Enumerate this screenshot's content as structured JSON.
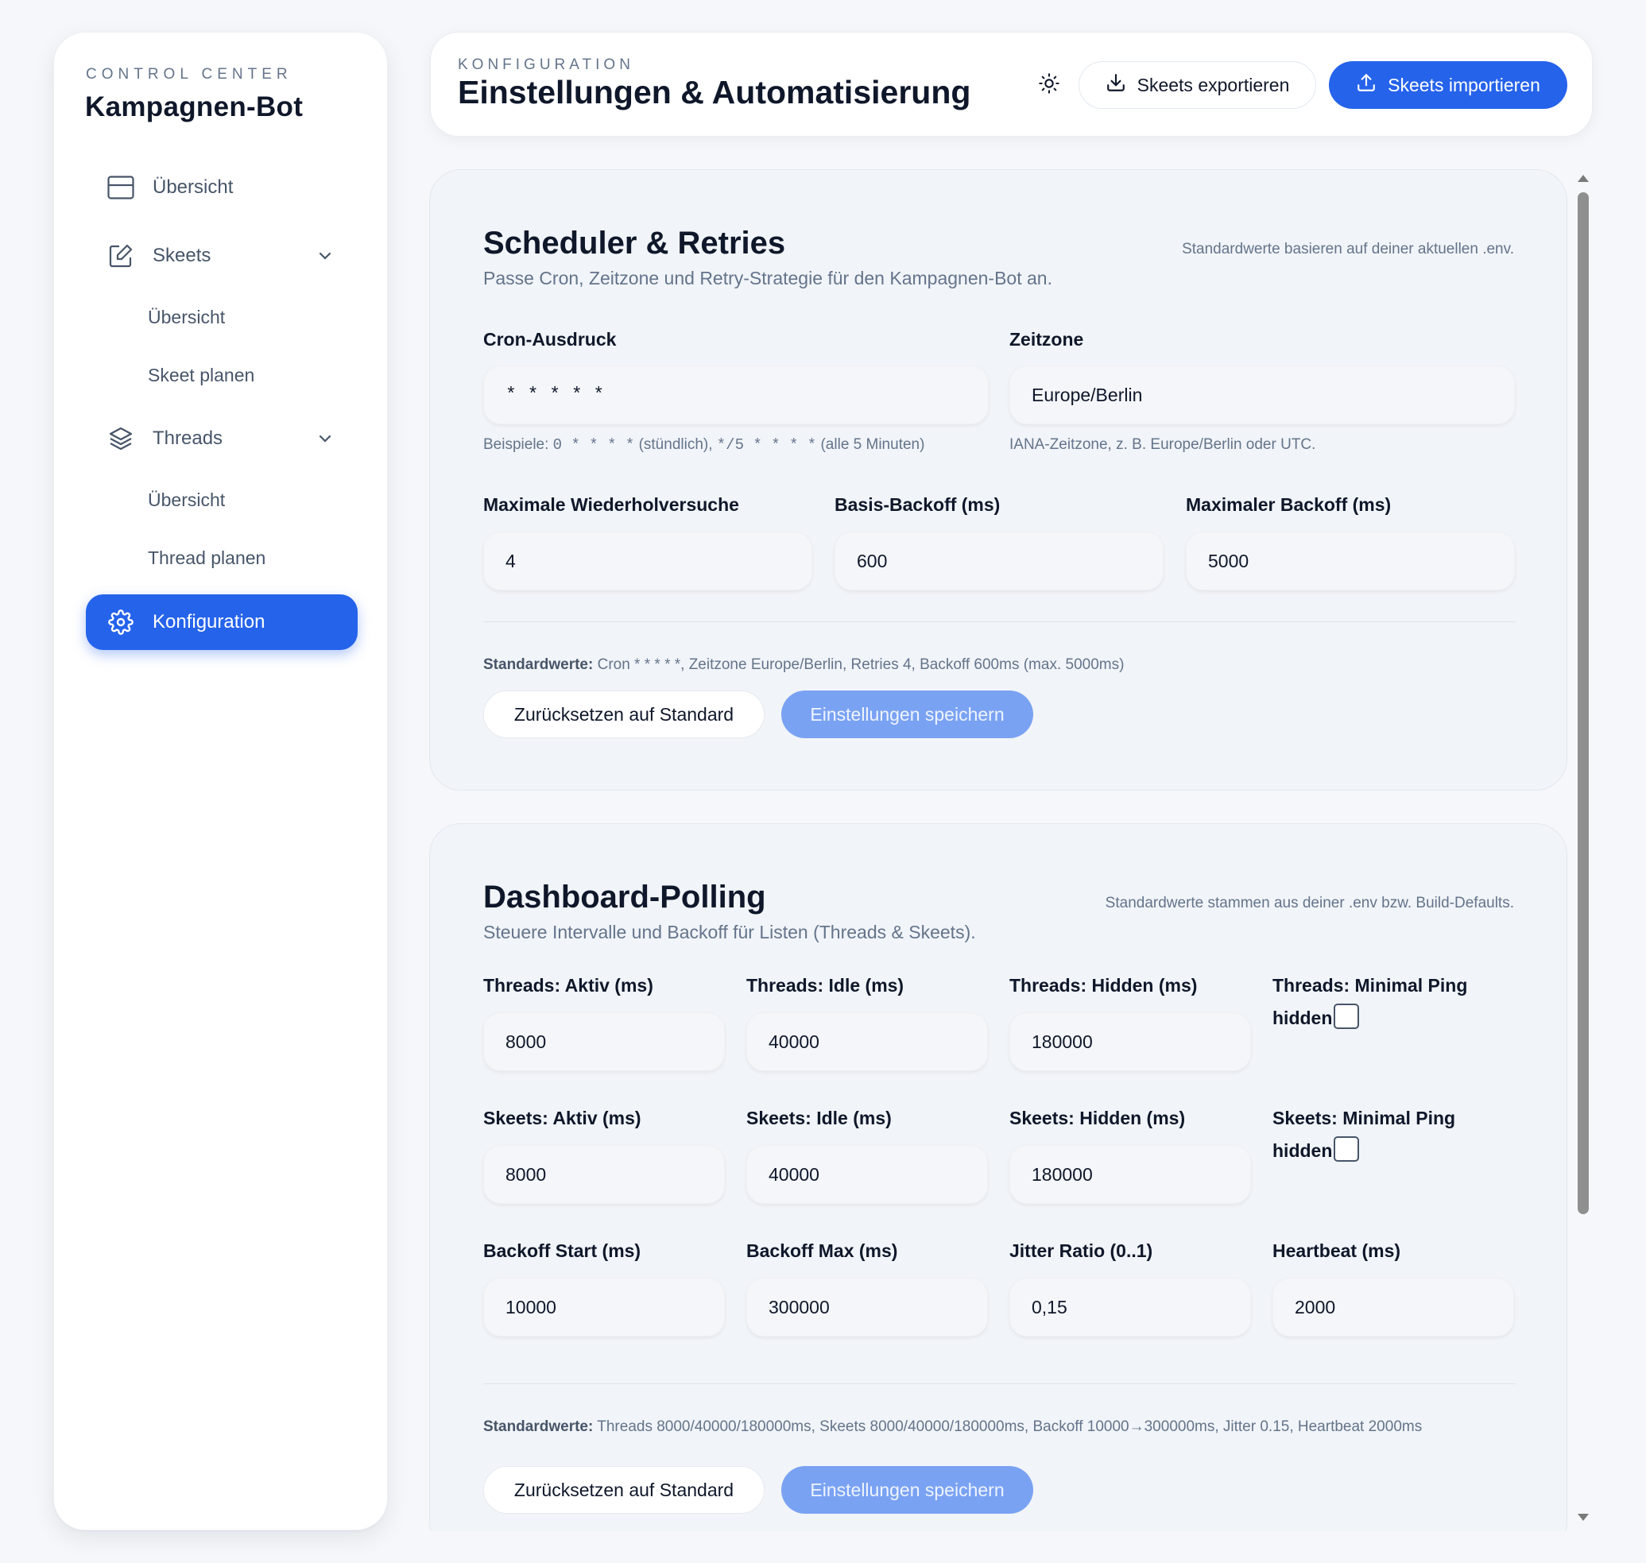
{
  "sidebar": {
    "kicker": "CONTROL CENTER",
    "title": "Kampagnen-Bot",
    "items": [
      {
        "label": "Übersicht",
        "icon": "layout-icon"
      },
      {
        "label": "Skeets",
        "icon": "edit-icon"
      },
      {
        "label": "Übersicht"
      },
      {
        "label": "Skeet planen"
      },
      {
        "label": "Threads",
        "icon": "layers-icon"
      },
      {
        "label": "Übersicht"
      },
      {
        "label": "Thread planen"
      },
      {
        "label": "Konfiguration",
        "icon": "gear-icon",
        "active": true
      }
    ]
  },
  "header": {
    "kicker": "KONFIGURATION",
    "title": "Einstellungen & Automatisierung",
    "export_label": "Skeets exportieren",
    "import_label": "Skeets importieren"
  },
  "scheduler": {
    "title": "Scheduler & Retries",
    "subtitle": "Passe Cron, Zeitzone und Retry-Strategie für den Kampagnen-Bot an.",
    "note": "Standardwerte basieren auf deiner aktuellen .env.",
    "cron_label": "Cron-Ausdruck",
    "cron_value": "* * * * *",
    "cron_help_prefix": "Beispiele: ",
    "cron_help_ex1": "0 * * * *",
    "cron_help_mid": " (stündlich), ",
    "cron_help_ex2": "*/5 * * * *",
    "cron_help_suffix": " (alle 5 Minuten)",
    "tz_label": "Zeitzone",
    "tz_value": "Europe/Berlin",
    "tz_help": "IANA-Zeitzone, z. B. Europe/Berlin oder UTC.",
    "retries_label": "Maximale Wiederholversuche",
    "retries_value": "4",
    "backoff_label": "Basis-Backoff (ms)",
    "backoff_value": "600",
    "maxbackoff_label": "Maximaler Backoff (ms)",
    "maxbackoff_value": "5000",
    "defaults_label": "Standardwerte:",
    "defaults_text": " Cron * * * * *, Zeitzone Europe/Berlin, Retries 4, Backoff 600ms (max. 5000ms)",
    "reset_label": "Zurücksetzen auf Standard",
    "save_label": "Einstellungen speichern"
  },
  "polling": {
    "title": "Dashboard-Polling",
    "subtitle": "Steuere Intervalle und Backoff für Listen (Threads & Skeets).",
    "note": "Standardwerte stammen aus deiner .env bzw. Build-Defaults.",
    "threads_active_label": "Threads: Aktiv (ms)",
    "threads_active_value": "8000",
    "threads_idle_label": "Threads: Idle (ms)",
    "threads_idle_value": "40000",
    "threads_hidden_label": "Threads: Hidden (ms)",
    "threads_hidden_value": "180000",
    "threads_ping_label": "Threads: Minimal Ping hidden",
    "skeets_active_label": "Skeets: Aktiv (ms)",
    "skeets_active_value": "8000",
    "skeets_idle_label": "Skeets: Idle (ms)",
    "skeets_idle_value": "40000",
    "skeets_hidden_label": "Skeets: Hidden (ms)",
    "skeets_hidden_value": "180000",
    "skeets_ping_label": "Skeets: Minimal Ping hidden",
    "backoff_start_label": "Backoff Start (ms)",
    "backoff_start_value": "10000",
    "backoff_max_label": "Backoff Max (ms)",
    "backoff_max_value": "300000",
    "jitter_label": "Jitter Ratio (0..1)",
    "jitter_value": "0,15",
    "heartbeat_label": "Heartbeat (ms)",
    "heartbeat_value": "2000",
    "defaults_label": "Standardwerte:",
    "defaults_text": " Threads 8000/40000/180000ms, Skeets 8000/40000/180000ms, Backoff 10000→300000ms, Jitter 0.15, Heartbeat 2000ms",
    "reset_label": "Zurücksetzen auf Standard",
    "save_label": "Einstellungen speichern"
  },
  "colors": {
    "accent": "#2563eb",
    "accent_disabled": "#7aa2f3",
    "background": "#f5f7fa",
    "card": "#f1f4f8"
  }
}
